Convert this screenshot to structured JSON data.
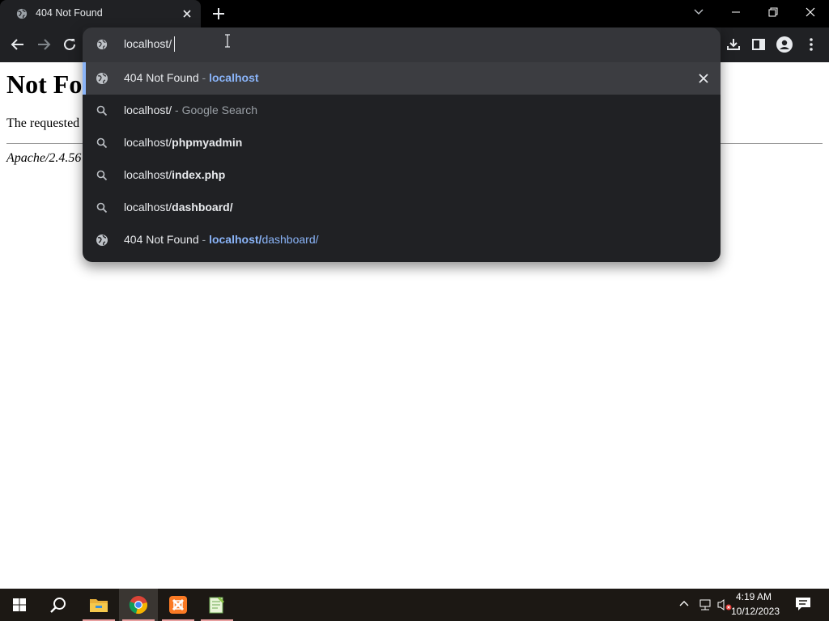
{
  "browser": {
    "tab_title": "404 Not Found",
    "omnibox_text": "localhost/"
  },
  "page": {
    "heading": "Not Fo",
    "paragraph": "The requested",
    "address": "Apache/2.4.56"
  },
  "suggestions": [
    {
      "main": "404 Not Found",
      "sep": " - ",
      "host": "localhost",
      "path": "",
      "icon": "globe-icon"
    },
    {
      "main": "localhost/",
      "sep": " - ",
      "extra": "Google Search",
      "icon": "search-icon"
    },
    {
      "prefix": "localhost/",
      "bold": "phpmyadmin",
      "icon": "search-icon"
    },
    {
      "prefix": "localhost/",
      "bold": "index.php",
      "icon": "search-icon"
    },
    {
      "prefix": "localhost/",
      "bold": "dashboard/",
      "icon": "search-icon"
    },
    {
      "main": "404 Not Found",
      "sep": " - ",
      "host": "localhost/",
      "path": "dashboard/",
      "icon": "globe-icon"
    }
  ],
  "taskbar": {
    "time": "4:19 AM",
    "date": "10/12/2023",
    "apps": [
      "start-icon",
      "search-icon",
      "file-explorer-icon",
      "chrome-icon",
      "xampp-icon",
      "notepad-plus-icon"
    ]
  },
  "colors": {
    "accent": "#8ab4f8",
    "toolbar": "#202124",
    "omnibox_input": "#35363a"
  }
}
